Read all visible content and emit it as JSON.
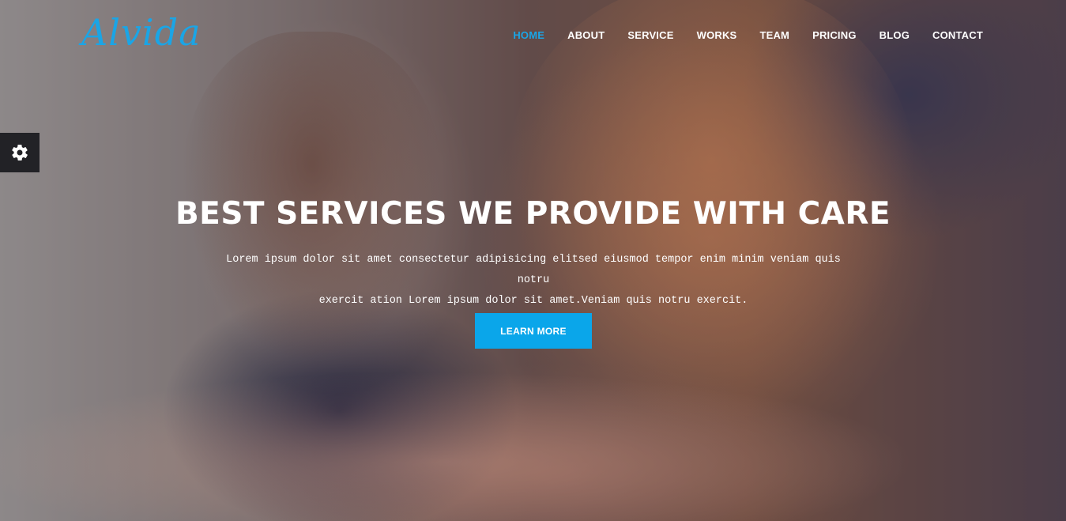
{
  "brand": {
    "logo_text": "Alvida",
    "accent_color": "#1aa5e6"
  },
  "nav": {
    "items": [
      {
        "label": "HOME",
        "active": true
      },
      {
        "label": "ABOUT",
        "active": false
      },
      {
        "label": "SERVICE",
        "active": false
      },
      {
        "label": "WORKS",
        "active": false
      },
      {
        "label": "TEAM",
        "active": false
      },
      {
        "label": "PRICING",
        "active": false
      },
      {
        "label": "BLOG",
        "active": false
      },
      {
        "label": "CONTACT",
        "active": false
      }
    ]
  },
  "settings": {
    "icon": "gear-icon"
  },
  "hero": {
    "title": "BEST SERVICES WE PROVIDE WITH CARE",
    "text_line1": "Lorem ipsum dolor sit amet consectetur adipisicing elitsed eiusmod tempor enim minim veniam quis notru",
    "text_line2": "exercit ation Lorem ipsum dolor sit amet.Veniam quis notru exercit.",
    "button_label": "LEARN MORE",
    "button_color": "#0aa6ea"
  }
}
